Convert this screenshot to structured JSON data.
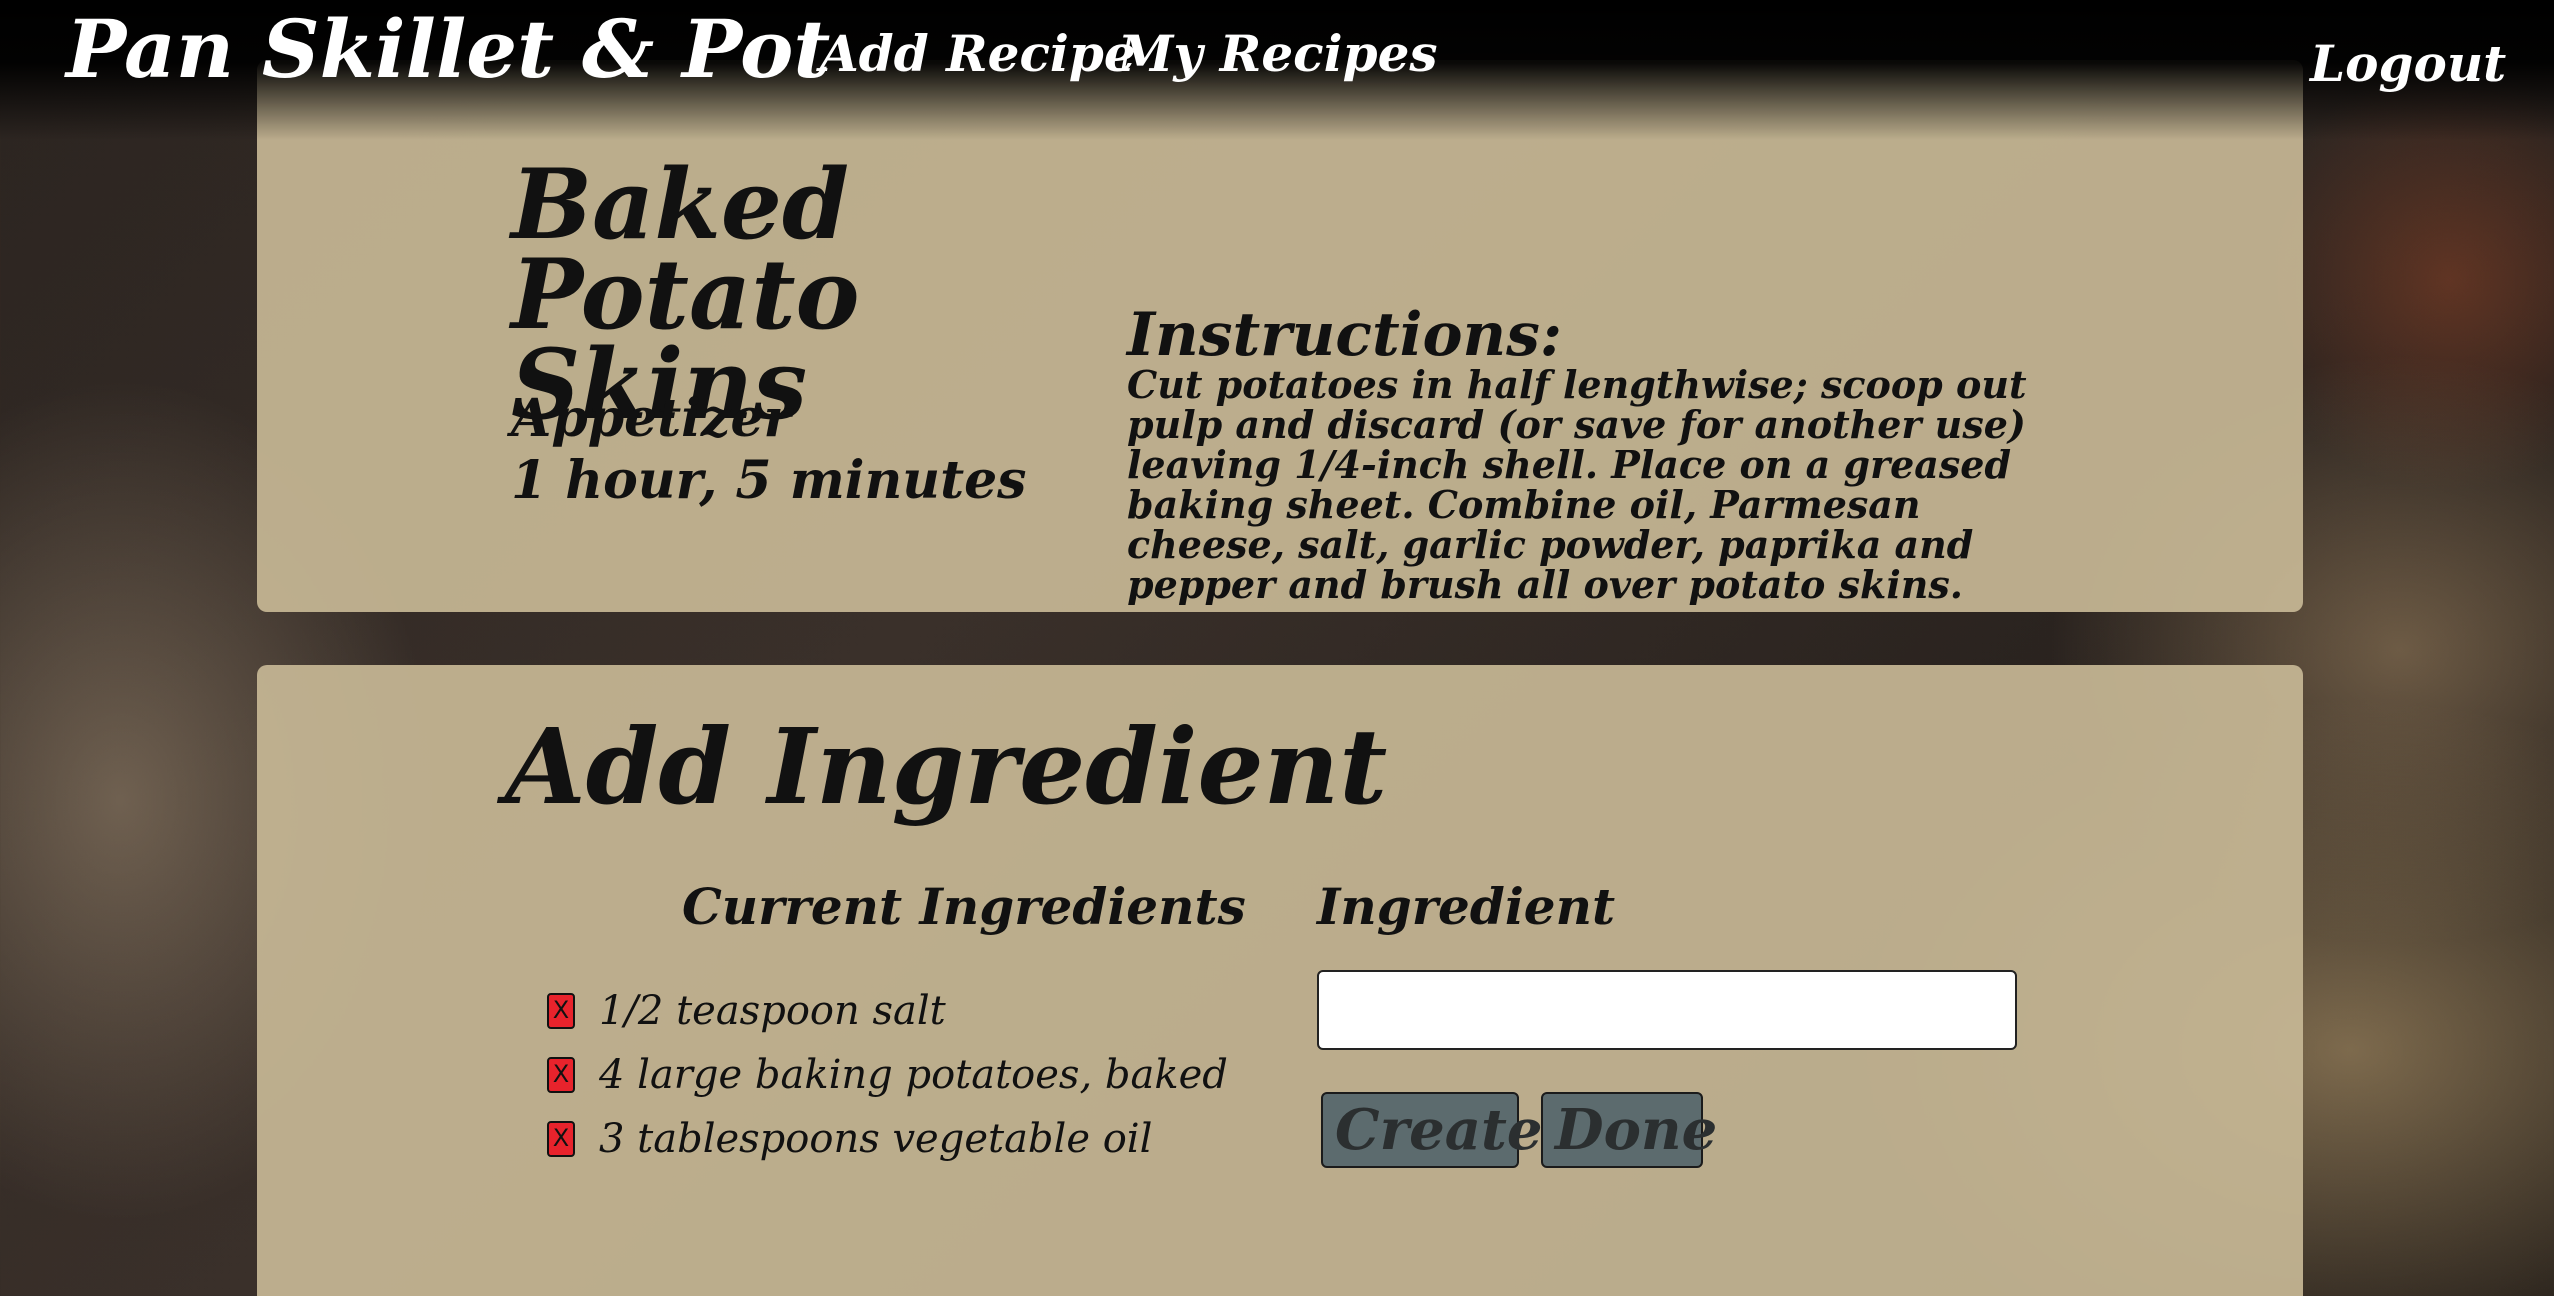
{
  "header": {
    "brand": "Pan Skillet & Pot",
    "nav": {
      "add_recipe": "Add Recipe",
      "my_recipes": "My Recipes",
      "logout": "Logout"
    }
  },
  "recipe": {
    "name": "Baked Potato Skins",
    "category": "Appetizer",
    "time": "1 hour, 5 minutes",
    "instructions_heading": "Instructions:",
    "instructions": "Cut potatoes in half lengthwise; scoop out pulp and discard (or save for another use) leaving 1/4-inch shell. Place on a greased baking sheet. Combine oil, Parmesan cheese, salt, garlic powder, paprika and pepper and brush all over potato skins. Bake at"
  },
  "add_ingredient": {
    "heading": "Add Ingredient",
    "current_heading": "Current Ingredients",
    "remove_label": "X",
    "ingredients": [
      "1/2 teaspoon salt",
      "4 large baking potatoes, baked",
      "3 tablespoons vegetable oil"
    ],
    "input_label": "Ingredient",
    "input_value": "",
    "create_label": "Create",
    "done_label": "Done"
  },
  "colors": {
    "panel": "#c6b794",
    "remove_button": "#e8232c",
    "action_button": "#5c6b6e",
    "nav_text": "#ffffff"
  }
}
